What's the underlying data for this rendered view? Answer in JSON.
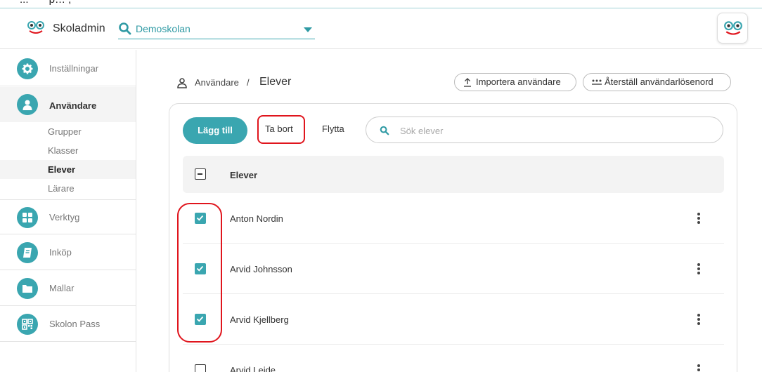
{
  "app": {
    "top_partial_text": "...       p… ,",
    "name": "Skoladmin",
    "school": "Demoskolan"
  },
  "sidebar": {
    "items": [
      {
        "label": "Inställningar",
        "icon": "gear-icon"
      },
      {
        "label": "Användare",
        "icon": "user-icon"
      },
      {
        "label": "Verktyg",
        "icon": "grid-icon"
      },
      {
        "label": "Inköp",
        "icon": "book-icon"
      },
      {
        "label": "Mallar",
        "icon": "folder-icon"
      },
      {
        "label": "Skolon Pass",
        "icon": "qr-icon"
      }
    ],
    "sub_items": [
      "Grupper",
      "Klasser",
      "Elever",
      "Lärare"
    ],
    "active_sub": "Elever"
  },
  "breadcrumb": {
    "parent": "Användare",
    "separator": "/",
    "current": "Elever"
  },
  "actions": {
    "import": "Importera användare",
    "reset_password": "Återställ användarlösenord"
  },
  "toolbar": {
    "add": "Lägg till",
    "remove": "Ta bort",
    "move": "Flytta",
    "search_placeholder": "Sök elever"
  },
  "table": {
    "header": "Elever",
    "rows": [
      {
        "name": "Anton Nordin",
        "checked": true
      },
      {
        "name": "Arvid Johnsson",
        "checked": true
      },
      {
        "name": "Arvid Kjellberg",
        "checked": true
      },
      {
        "name": "Arvid Leide",
        "checked": false
      }
    ]
  },
  "colors": {
    "accent": "#3aa6b0",
    "annotation": "#e0151d"
  }
}
